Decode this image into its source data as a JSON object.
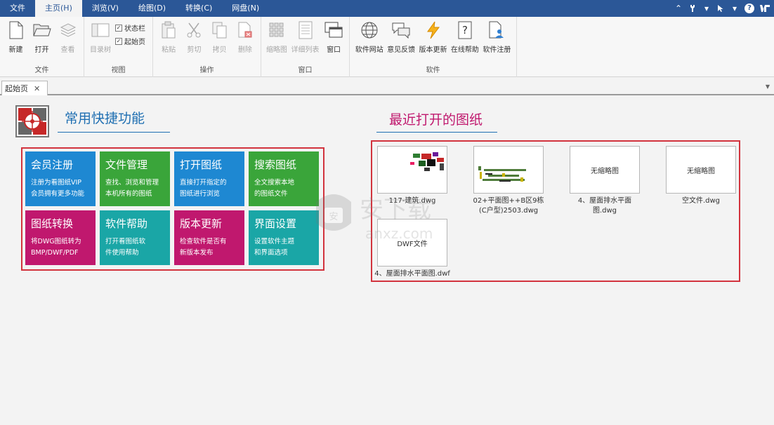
{
  "menu": {
    "tabs": [
      "文件",
      "主页(H)",
      "浏览(V)",
      "绘图(D)",
      "转换(C)",
      "网盘(N)"
    ],
    "active_index": 1
  },
  "ribbon": {
    "file_group": {
      "label": "文件",
      "new": "新建",
      "open": "打开",
      "view": "查看"
    },
    "view_group": {
      "label": "视图",
      "dir_tree": "目录树",
      "status_bar": "状态栏",
      "start_page": "起始页"
    },
    "ops_group": {
      "label": "操作",
      "paste": "粘贴",
      "cut": "剪切",
      "copy": "拷贝",
      "delete": "删除"
    },
    "window_group": {
      "label": "窗口",
      "thumbs": "缩略图",
      "detail_list": "详细列表",
      "window": "窗口"
    },
    "software_group": {
      "label": "软件",
      "website": "软件网站",
      "feedback": "意见反馈",
      "update": "版本更新",
      "online_help": "在线帮助",
      "register": "软件注册"
    }
  },
  "doc_tab": {
    "label": "起始页",
    "close": "✕"
  },
  "quick": {
    "title": "常用快捷功能",
    "tiles": [
      {
        "title": "会员注册",
        "line1": "注册为看图纸VIP",
        "line2": "会员拥有更多功能",
        "color": "#1e88d2"
      },
      {
        "title": "文件管理",
        "line1": "查找、浏览和管理",
        "line2": "本机所有的图纸",
        "color": "#3aa53a"
      },
      {
        "title": "打开图纸",
        "line1": "直接打开指定的",
        "line2": "图纸进行浏览",
        "color": "#1e88d2"
      },
      {
        "title": "搜索图纸",
        "line1": "全文搜索本地",
        "line2": "的图纸文件",
        "color": "#3aa53a"
      },
      {
        "title": "图纸转换",
        "line1": "将DWG图纸转为",
        "line2": "BMP/DWF/PDF",
        "color": "#c0186e"
      },
      {
        "title": "软件帮助",
        "line1": "打开看图纸软",
        "line2": "件使用帮助",
        "color": "#1aa6a6"
      },
      {
        "title": "版本更新",
        "line1": "检查软件是否有",
        "line2": "新版本发布",
        "color": "#c0186e"
      },
      {
        "title": "界面设置",
        "line1": "设置软件主题",
        "line2": "和界面选项",
        "color": "#1aa6a6"
      }
    ]
  },
  "recent": {
    "title": "最近打开的图纸",
    "files": [
      {
        "name": "117-建筑.dwg",
        "thumb_text": ""
      },
      {
        "name": "02+平面图++B区9栋(C户型)2503.dwg",
        "thumb_text": ""
      },
      {
        "name": "4、屋面排水平面图.dwg",
        "thumb_text": "无缩略图"
      },
      {
        "name": "空文件.dwg",
        "thumb_text": "无缩略图"
      },
      {
        "name": "4、屋面排水平面图.dwf",
        "thumb_text": "DWF文件"
      }
    ]
  },
  "watermark": {
    "text": "安下载",
    "sub": "anxz.com"
  }
}
